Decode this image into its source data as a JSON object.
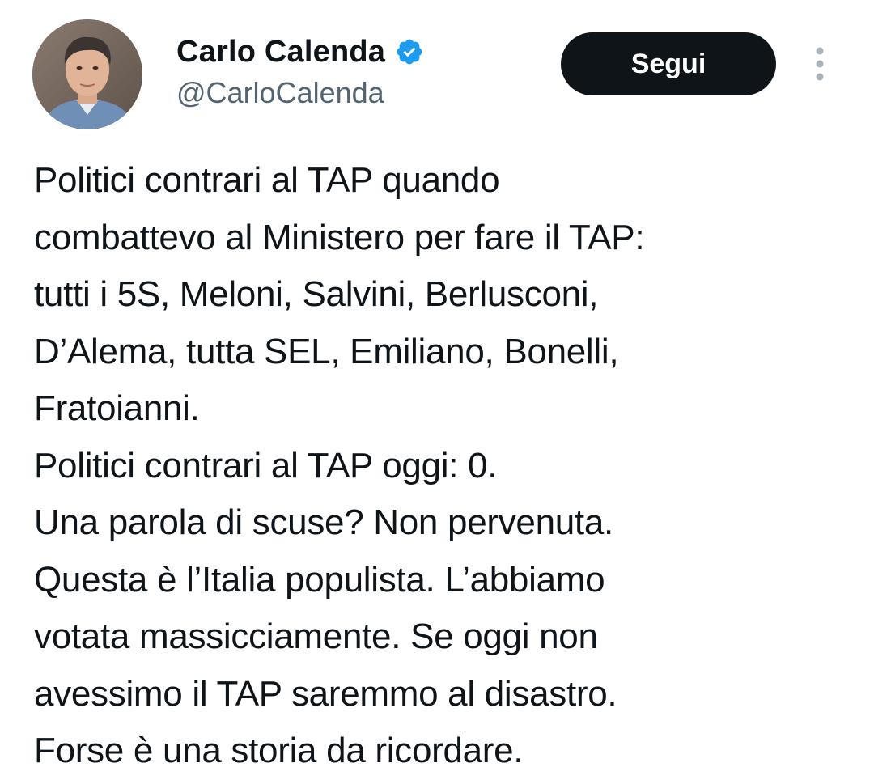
{
  "author": {
    "display_name": "Carlo Calenda",
    "handle": "@CarloCalenda",
    "verified": true,
    "verified_color": "#1d9bf0"
  },
  "actions": {
    "follow_label": "Segui",
    "more_icon": "more-vertical-icon"
  },
  "tweet": {
    "lines": [
      "Politici contrari al TAP quando",
      "combattevo al Ministero per fare il TAP:",
      "tutti i 5S, Meloni, Salvini, Berlusconi,",
      "D’Alema, tutta SEL, Emiliano, Bonelli,",
      "Fratoianni.",
      "Politici contrari al TAP oggi: 0.",
      "Una parola di scuse? Non pervenuta.",
      "Questa è l’Italia populista. L’abbiamo",
      "votata massicciamente. Se oggi non",
      "avessimo il TAP saremmo al disastro.",
      "Forse è una storia da ricordare."
    ]
  },
  "colors": {
    "text_primary": "#0f1419",
    "text_secondary": "#536471",
    "button_bg": "#0f1419",
    "button_text": "#ffffff"
  }
}
